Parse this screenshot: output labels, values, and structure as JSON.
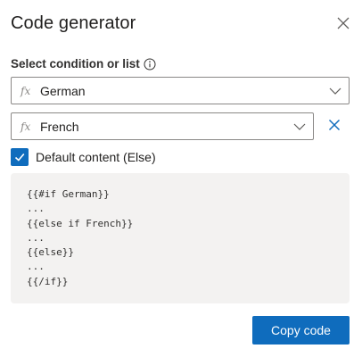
{
  "dialog": {
    "title": "Code generator",
    "close_icon": "close-icon"
  },
  "condition": {
    "label": "Select condition or list",
    "info_icon": "info-icon",
    "selects": [
      {
        "prefix": "fx",
        "value": "German"
      },
      {
        "prefix": "fx",
        "value": "French"
      }
    ],
    "remove_icon": "remove-icon"
  },
  "default_content": {
    "label": "Default content (Else)",
    "checked": true
  },
  "code": {
    "lines": [
      "{{#if German}}",
      "...",
      "{{else if French}}",
      "...",
      "{{else}}",
      "...",
      "{{/if}}"
    ]
  },
  "actions": {
    "copy_label": "Copy code"
  },
  "colors": {
    "accent": "#0f6cbd",
    "code_background": "#f3f2f1"
  }
}
